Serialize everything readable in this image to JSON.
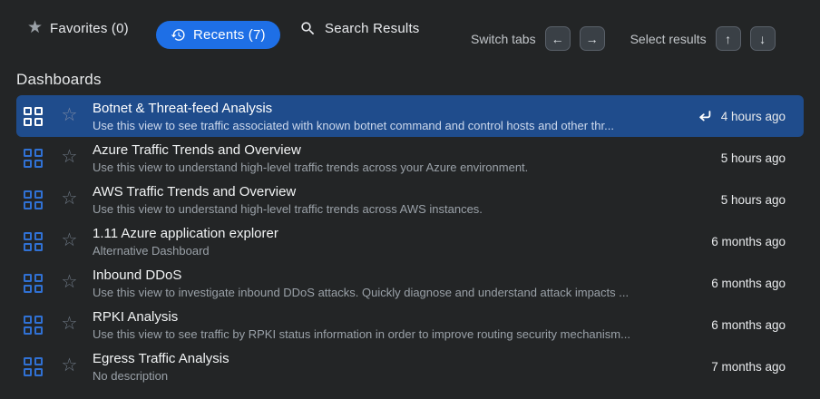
{
  "header": {
    "tabs": [
      {
        "label": "Favorites (0)"
      },
      {
        "label": "Recents (7)"
      },
      {
        "label": "Search Results"
      }
    ],
    "switch_tabs_label": "Switch tabs",
    "select_results_label": "Select results",
    "icons": {
      "left_arrow": "←",
      "right_arrow": "→",
      "up_arrow": "↑",
      "down_arrow": "↓",
      "favorites_star": "★",
      "row_star": "☆"
    }
  },
  "section": {
    "title": "Dashboards"
  },
  "rows": [
    {
      "title": "Botnet & Threat-feed Analysis",
      "description": "Use this view to see traffic associated with known botnet command and control hosts and other thr...",
      "timestamp": "4 hours ago",
      "selected": true
    },
    {
      "title": "Azure Traffic Trends and Overview",
      "description": "Use this view to understand high-level traffic trends across your Azure environment.",
      "timestamp": "5 hours ago",
      "selected": false
    },
    {
      "title": "AWS Traffic Trends and Overview",
      "description": "Use this view to understand high-level traffic trends across AWS instances.",
      "timestamp": "5 hours ago",
      "selected": false
    },
    {
      "title": "1.11 Azure application explorer",
      "description": "Alternative Dashboard",
      "timestamp": "6 months ago",
      "selected": false
    },
    {
      "title": "Inbound DDoS",
      "description": "Use this view to investigate inbound DDoS attacks. Quickly diagnose and understand attack impacts ...",
      "timestamp": "6 months ago",
      "selected": false
    },
    {
      "title": "RPKI Analysis",
      "description": "Use this view to see traffic by RPKI status information in order to improve routing security mechanism...",
      "timestamp": "6 months ago",
      "selected": false
    },
    {
      "title": "Egress Traffic Analysis",
      "description": "No description",
      "timestamp": "7 months ago",
      "selected": false
    }
  ],
  "colors": {
    "accent_blue": "#1e6fe6",
    "selected_row_blue": "#1f4c8c",
    "grid_icon_blue": "#3071d4",
    "background": "#232526"
  }
}
